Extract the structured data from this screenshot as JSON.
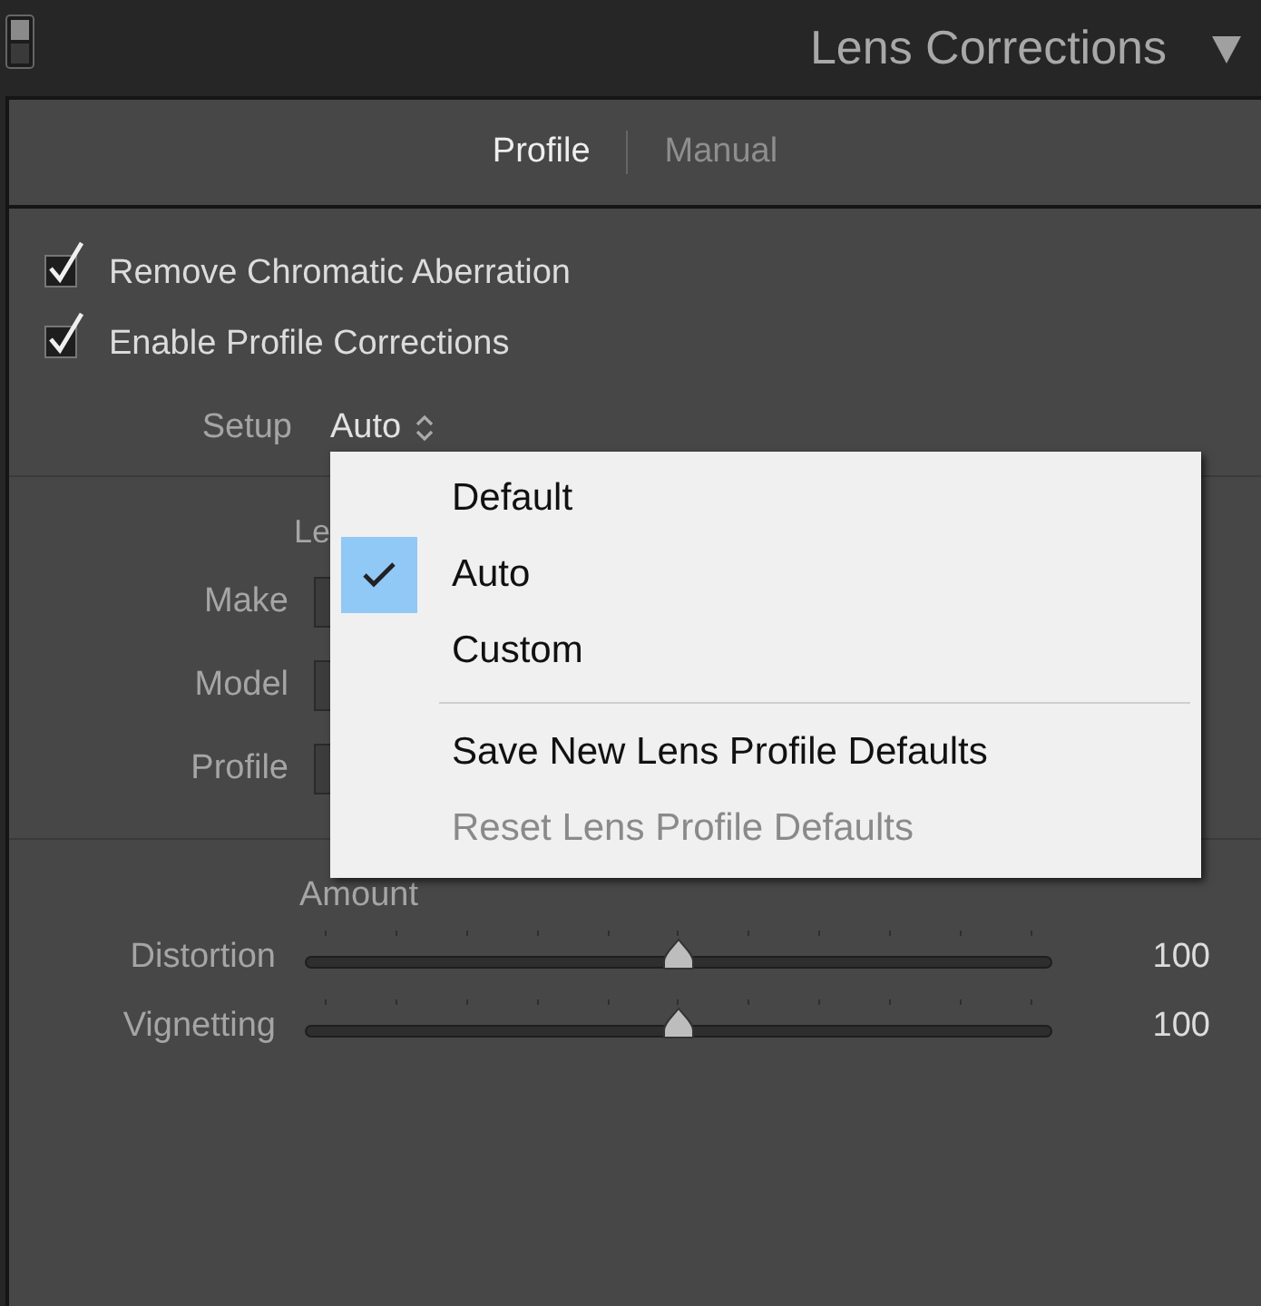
{
  "panel": {
    "title": "Lens Corrections",
    "expanded": true
  },
  "tabs": [
    {
      "label": "Profile",
      "selected": true
    },
    {
      "label": "Manual",
      "selected": false
    }
  ],
  "options": [
    {
      "label": "Remove Chromatic Aberration",
      "checked": true
    },
    {
      "label": "Enable Profile Corrections",
      "checked": true
    }
  ],
  "setup": {
    "label": "Setup",
    "value": "Auto"
  },
  "lens_profile": {
    "heading": "Le",
    "fields": [
      {
        "label": "Make"
      },
      {
        "label": "Model"
      },
      {
        "label": "Profile"
      }
    ]
  },
  "amount": {
    "heading": "Amount",
    "sliders": [
      {
        "label": "Distortion",
        "level": 0.5,
        "reading": "100"
      },
      {
        "label": "Vignetting",
        "level": 0.5,
        "reading": "100"
      }
    ]
  },
  "setup_menu": {
    "items": [
      {
        "kind": "option",
        "label": "Default",
        "selected": false
      },
      {
        "kind": "option",
        "label": "Auto",
        "selected": true
      },
      {
        "kind": "option",
        "label": "Custom",
        "selected": false
      },
      {
        "kind": "separator"
      },
      {
        "kind": "command",
        "label": "Save New Lens Profile Defaults",
        "disabled": false
      },
      {
        "kind": "command",
        "label": "Reset Lens Profile Defaults",
        "disabled": true
      }
    ]
  }
}
